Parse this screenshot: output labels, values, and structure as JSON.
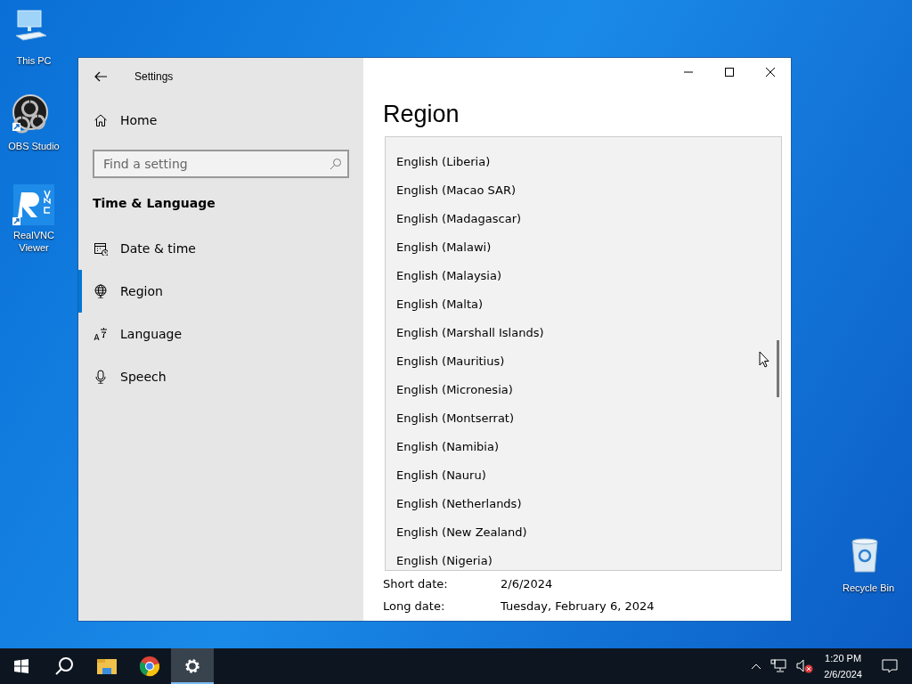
{
  "desktop_icons": [
    {
      "label": "This PC",
      "kind": "pc"
    },
    {
      "label": "OBS Studio",
      "kind": "obs"
    },
    {
      "label": "RealVNC Viewer",
      "kind": "vnc"
    },
    {
      "label": "Recycle Bin",
      "kind": "bin"
    }
  ],
  "window": {
    "title": "Settings"
  },
  "sidebar": {
    "home": "Home",
    "search": {
      "placeholder": "Find a setting"
    },
    "section": "Time & Language",
    "items": [
      {
        "label": "Date & time",
        "kind": "calendar",
        "selected": false
      },
      {
        "label": "Region",
        "kind": "globe",
        "selected": true
      },
      {
        "label": "Language",
        "kind": "language",
        "selected": false
      },
      {
        "label": "Speech",
        "kind": "mic",
        "selected": false
      }
    ]
  },
  "content": {
    "heading": "Region",
    "formats": [
      {
        "label": "Short date:",
        "value": "2/6/2024"
      },
      {
        "label": "Long date:",
        "value": "Tuesday, February 6, 2024"
      }
    ]
  },
  "dropdown": {
    "items": [
      {
        "label": "English (Liberia)",
        "selected": false
      },
      {
        "label": "English (Macao SAR)",
        "selected": false
      },
      {
        "label": "English (Madagascar)",
        "selected": false
      },
      {
        "label": "English (Malawi)",
        "selected": false
      },
      {
        "label": "English (Malaysia)",
        "selected": false
      },
      {
        "label": "English (Malta)",
        "selected": false
      },
      {
        "label": "English (Marshall Islands)",
        "selected": false
      },
      {
        "label": "English (Mauritius)",
        "selected": false
      },
      {
        "label": "English (Micronesia)",
        "selected": false
      },
      {
        "label": "English (Montserrat)",
        "selected": false
      },
      {
        "label": "English (Namibia)",
        "selected": false
      },
      {
        "label": "English (Nauru)",
        "selected": false
      },
      {
        "label": "English (Netherlands)",
        "selected": false
      },
      {
        "label": "English (New Zealand)",
        "selected": false
      },
      {
        "label": "English (Nigeria)",
        "selected": false
      }
    ]
  },
  "taskbar": {
    "apps": [
      {
        "kind": "start",
        "selected": false
      },
      {
        "kind": "search",
        "selected": false
      },
      {
        "kind": "explorer",
        "selected": false
      },
      {
        "kind": "chrome",
        "selected": false
      },
      {
        "kind": "settings",
        "selected": true
      }
    ],
    "time": "1:20 PM",
    "date": "2/6/2024"
  }
}
